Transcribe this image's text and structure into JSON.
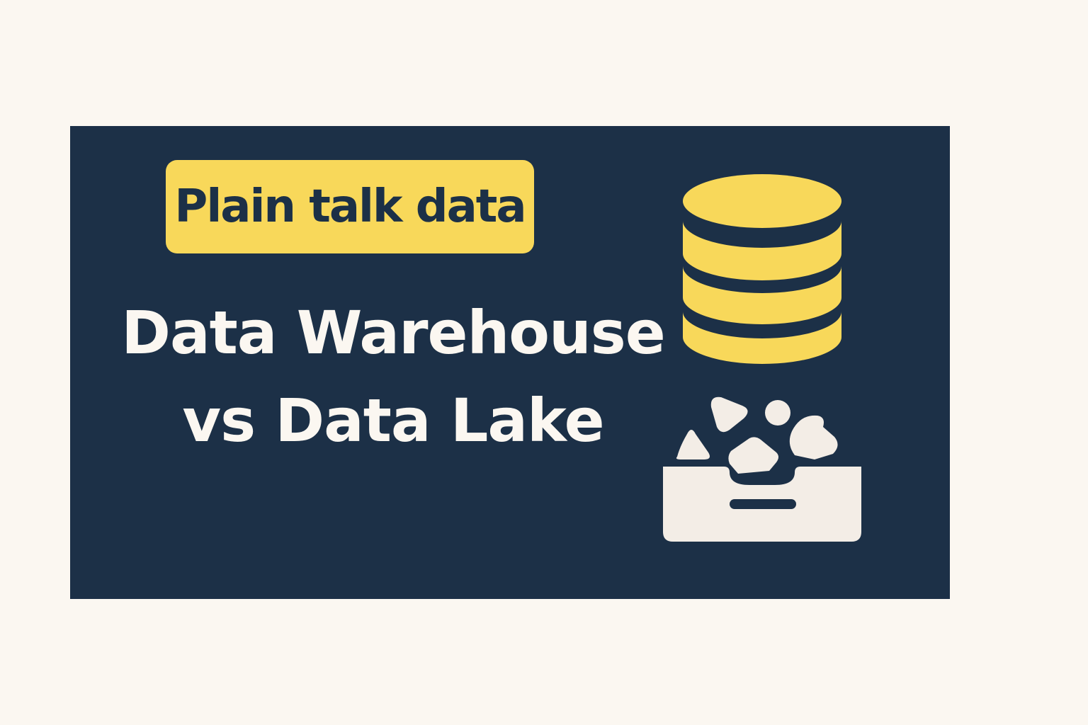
{
  "badge": {
    "label": "Plain talk data"
  },
  "headline": {
    "line1": "Data Warehouse",
    "line2": "vs Data Lake"
  },
  "icons": {
    "warehouse": "database-icon",
    "lake": "data-lake-tray-icon"
  },
  "colors": {
    "page_background": "#fbf7f1",
    "card_background": "#1c3047",
    "accent_yellow": "#f8d85a",
    "light_text": "#fbf7f1"
  }
}
